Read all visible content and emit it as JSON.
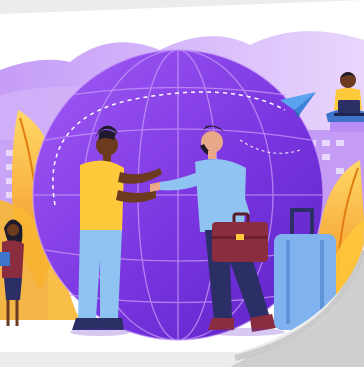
{
  "illustration": {
    "subject": "business-partnership-handshake",
    "icons": [
      "globe-icon",
      "paper-plane-icon",
      "briefcase-icon",
      "suitcase-icon",
      "laptop-icon"
    ],
    "colors": {
      "background": "#ececec",
      "card": "#ffffff",
      "purple_dark": "#6e2fd6",
      "purple_mid": "#8e4ef0",
      "purple_light": "#b98df5",
      "lavender": "#d9c4fb",
      "orange_leaf": "#f5a623",
      "yellow_leaf": "#ffd24a",
      "shirt_yellow": "#ffc93c",
      "shirt_blue": "#8fc3f2",
      "pants_blue": "#3e74c9",
      "pants_navy": "#2b2f66",
      "briefcase": "#8a2d3e",
      "suitcase": "#7fb2ef",
      "skin_dark": "#6b3a1f",
      "skin_light": "#e8a889"
    }
  }
}
